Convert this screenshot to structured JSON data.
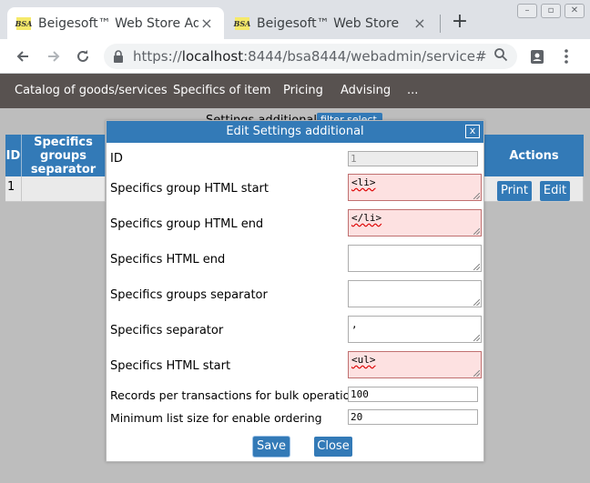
{
  "browser": {
    "tabs": [
      {
        "favicon": "BSA",
        "title": "Beigesoft™ Web Store Adm",
        "active": true
      },
      {
        "favicon": "BSA",
        "title": "Beigesoft™ Web Store",
        "active": false
      }
    ],
    "new_tab_symbol": "+",
    "tab_close_symbol": "×",
    "url_scheme": "https://",
    "url_host": "localhost",
    "url_rest": ":8444/bsa8444/webadmin/service#"
  },
  "nav": {
    "items": [
      "Catalog of goods/services",
      "Specifics of item",
      "Pricing",
      "Advising",
      "..."
    ]
  },
  "background": {
    "title": "Settings additional",
    "filter_label": "filter select",
    "columns": [
      "ID",
      "Specifics groups separator",
      "Actions"
    ],
    "row": {
      "id": "1"
    },
    "print_label": "Print",
    "edit_label": "Edit"
  },
  "modal": {
    "title": "Edit Settings additional",
    "close_label": "x",
    "fields": {
      "id": {
        "label": "ID",
        "value": "1"
      },
      "group_start": {
        "label": "Specifics group HTML start",
        "value": "<li>"
      },
      "group_end": {
        "label": "Specifics group HTML end",
        "value": "</li>"
      },
      "html_end": {
        "label": "Specifics HTML end",
        "value": ""
      },
      "groups_sep": {
        "label": "Specifics groups separator",
        "value": ""
      },
      "spec_sep": {
        "label": "Specifics separator",
        "value": ","
      },
      "html_start": {
        "label": "Specifics HTML start",
        "value": "<ul>"
      },
      "bulk": {
        "label": "Records per transactions for bulk operations",
        "value": "100"
      },
      "min_list": {
        "label": "Minimum list size for enable ordering",
        "value": "20"
      }
    },
    "save_label": "Save",
    "close_button_label": "Close"
  },
  "colors": {
    "accent": "#337ab7",
    "navbar": "#585250",
    "invalid_field": "#fde1e1"
  },
  "icons": [
    "back-arrow-icon",
    "forward-arrow-icon",
    "reload-icon",
    "lock-icon",
    "zoom-icon",
    "profile-icon",
    "menu-icon"
  ]
}
